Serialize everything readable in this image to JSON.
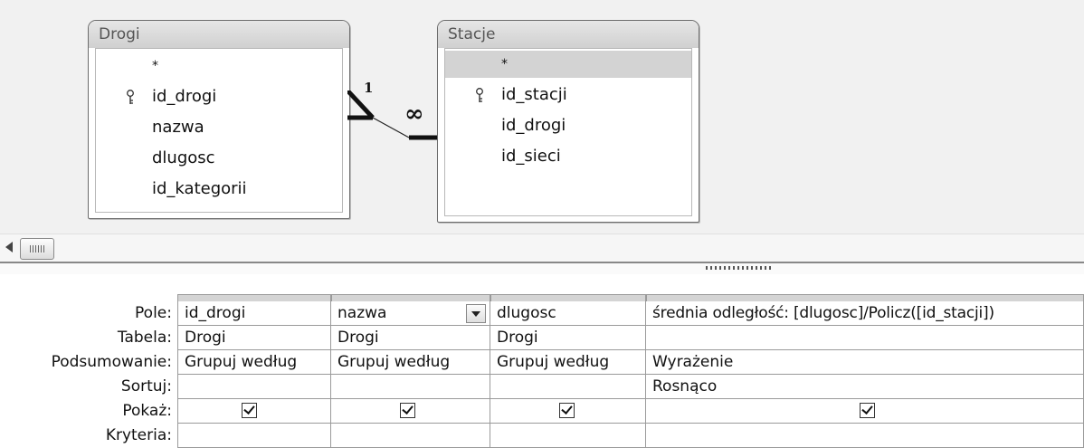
{
  "tables": [
    {
      "title": "Drogi",
      "fields": [
        "*",
        "id_drogi",
        "nazwa",
        "dlugosc",
        "id_kategorii"
      ],
      "key_field": "id_drogi"
    },
    {
      "title": "Stacje",
      "fields": [
        "*",
        "id_stacji",
        "id_drogi",
        "id_sieci"
      ],
      "key_field": "id_stacji",
      "selected_field": "*"
    }
  ],
  "relationship": {
    "one_label": "1",
    "many_label": "∞"
  },
  "icons": {
    "key": "key-icon",
    "scroll_left": "arrow-left-icon",
    "dropdown": "chevron-down-icon",
    "checkbox": "checkmark-icon"
  },
  "grid": {
    "row_labels": [
      "Pole:",
      "Tabela:",
      "Podsumowanie:",
      "Sortuj:",
      "Pokaż:",
      "Kryteria:"
    ],
    "columns": [
      {
        "field": "id_drogi",
        "table": "Drogi",
        "total": "Grupuj według",
        "sort": "",
        "show": true
      },
      {
        "field": "nazwa",
        "table": "Drogi",
        "total": "Grupuj według",
        "sort": "",
        "show": true,
        "has_dropdown": true
      },
      {
        "field": "dlugosc",
        "table": "Drogi",
        "total": "Grupuj według",
        "sort": "",
        "show": true
      },
      {
        "field": "średnia odległość: [dlugosc]/Policz([id_stacji])",
        "table": "",
        "total": "Wyrażenie",
        "sort": "Rosnąco",
        "show": true
      }
    ]
  }
}
